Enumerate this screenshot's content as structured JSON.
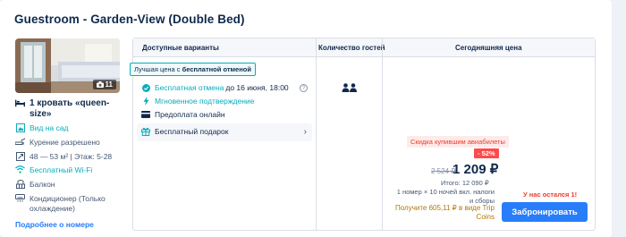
{
  "room": {
    "title": "Guestroom - Garden-View (Double Bed)",
    "photo_count": "11",
    "bed": "1 кровать «queen-size»",
    "features": [
      {
        "icon": "garden-icon",
        "text": "Вид на сад",
        "highlight": true
      },
      {
        "icon": "smoking-icon",
        "text": "Курение разрешено",
        "highlight": false
      },
      {
        "icon": "area-icon",
        "text": "48 — 53 м² | Этаж: 5-28",
        "highlight": false
      },
      {
        "icon": "wifi-icon",
        "text": "Бесплатный Wi-Fi",
        "highlight": true
      },
      {
        "icon": "balcony-icon",
        "text": "Балкон",
        "highlight": false
      },
      {
        "icon": "ac-icon",
        "text": "Кондиционер (Только охлаждение)",
        "highlight": false
      }
    ],
    "more_link": "Подробнее о номере"
  },
  "table": {
    "headers": {
      "options": "Доступные варианты",
      "guests": "Количество гостей",
      "price": "Сегодняшняя цена"
    },
    "best_badge_prefix": "Лучшая цена с",
    "best_badge_bold": "бесплатной отменой",
    "options": {
      "free_cancel": "Бесплатная отмена",
      "free_cancel_date": "до 16 июня, 18:00",
      "instant": "Мгновенное подтверждение",
      "prepay": "Предоплата онлайн",
      "gift": "Бесплатный подарок"
    },
    "price": {
      "promo": "Скидка купившим авиабилеты",
      "discount": "- 52%",
      "old": "2 524 ₽",
      "new": "1 209 ₽",
      "total": "Итого: 12 090 ₽",
      "nights": "1 номер × 10 ночей вкл. налоги и сборы",
      "coins": "Получите 605,11 ₽ в виде Trip Coins"
    },
    "left": "У нас остался 1!",
    "book": "Забронировать"
  },
  "colors": {
    "accent": "#287dfa",
    "teal": "#06aebd",
    "red": "#ee3b28",
    "navy": "#0f294d"
  }
}
